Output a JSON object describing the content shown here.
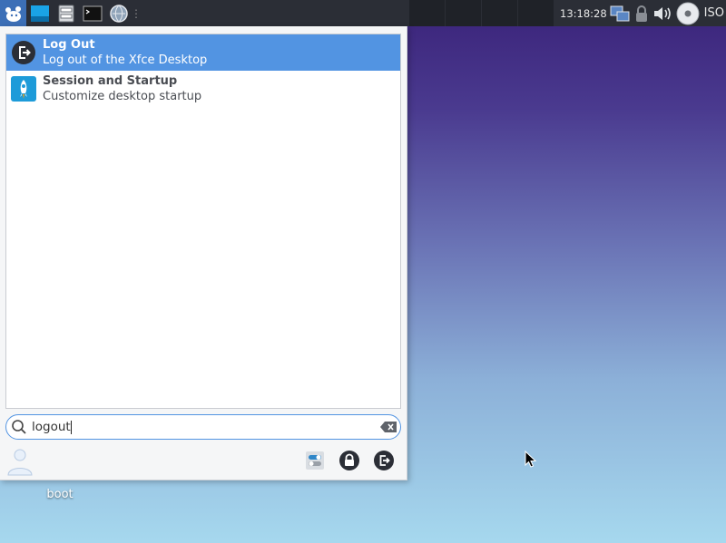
{
  "panel": {
    "clock": "13:18:28",
    "iso_label": "ISO"
  },
  "menu": {
    "results": [
      {
        "title": "Log Out",
        "description": "Log out of the Xfce Desktop",
        "icon": "logout-icon",
        "selected": true
      },
      {
        "title": "Session and Startup",
        "description": "Customize desktop startup",
        "icon": "rocket-icon",
        "selected": false
      }
    ],
    "search": {
      "value": "logout"
    }
  },
  "desktop": {
    "icon_label": "boot"
  },
  "colors": {
    "panel_bg": "#2b2e36",
    "selection": "#5294e2",
    "menu_bg": "#f5f6f7"
  }
}
